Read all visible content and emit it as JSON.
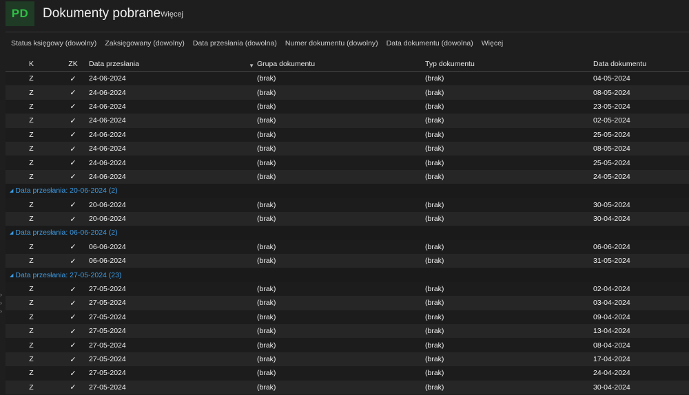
{
  "header": {
    "logo": "PD",
    "title": "Dokumenty pobrane",
    "more_label": "Więcej"
  },
  "filters": [
    "Status księgowy (dowolny)",
    "Zaksięgowany (dowolny)",
    "Data przesłania (dowolna)",
    "Numer dokumentu (dowolny)",
    "Data dokumentu (dowolna)",
    "Więcej"
  ],
  "columns": {
    "k": "K",
    "zk": "ZK",
    "data_przeslania": "Data przesłania",
    "grupa": "Grupa dokumentu",
    "typ": "Typ dokumentu",
    "data_dokumentu": "Data dokumentu"
  },
  "check_symbol": "✓",
  "sections": [
    {
      "group_label": "",
      "rows": [
        {
          "k": "Z",
          "dp": "24-06-2024",
          "grupa": "(brak)",
          "typ": "(brak)",
          "dd": "04-05-2024"
        },
        {
          "k": "Z",
          "dp": "24-06-2024",
          "grupa": "(brak)",
          "typ": "(brak)",
          "dd": "08-05-2024"
        },
        {
          "k": "Z",
          "dp": "24-06-2024",
          "grupa": "(brak)",
          "typ": "(brak)",
          "dd": "23-05-2024"
        },
        {
          "k": "Z",
          "dp": "24-06-2024",
          "grupa": "(brak)",
          "typ": "(brak)",
          "dd": "02-05-2024"
        },
        {
          "k": "Z",
          "dp": "24-06-2024",
          "grupa": "(brak)",
          "typ": "(brak)",
          "dd": "25-05-2024"
        },
        {
          "k": "Z",
          "dp": "24-06-2024",
          "grupa": "(brak)",
          "typ": "(brak)",
          "dd": "08-05-2024"
        },
        {
          "k": "Z",
          "dp": "24-06-2024",
          "grupa": "(brak)",
          "typ": "(brak)",
          "dd": "25-05-2024"
        },
        {
          "k": "Z",
          "dp": "24-06-2024",
          "grupa": "(brak)",
          "typ": "(brak)",
          "dd": "24-05-2024"
        }
      ]
    },
    {
      "group_label": "Data przesłania: 20-06-2024 (2)",
      "rows": [
        {
          "k": "Z",
          "dp": "20-06-2024",
          "grupa": "(brak)",
          "typ": "(brak)",
          "dd": "30-05-2024"
        },
        {
          "k": "Z",
          "dp": "20-06-2024",
          "grupa": "(brak)",
          "typ": "(brak)",
          "dd": "30-04-2024"
        }
      ]
    },
    {
      "group_label": "Data przesłania: 06-06-2024 (2)",
      "rows": [
        {
          "k": "Z",
          "dp": "06-06-2024",
          "grupa": "(brak)",
          "typ": "(brak)",
          "dd": "06-06-2024"
        },
        {
          "k": "Z",
          "dp": "06-06-2024",
          "grupa": "(brak)",
          "typ": "(brak)",
          "dd": "31-05-2024"
        }
      ]
    },
    {
      "group_label": "Data przesłania: 27-05-2024 (23)",
      "rows": [
        {
          "k": "Z",
          "dp": "27-05-2024",
          "grupa": "(brak)",
          "typ": "(brak)",
          "dd": "02-04-2024"
        },
        {
          "k": "Z",
          "dp": "27-05-2024",
          "grupa": "(brak)",
          "typ": "(brak)",
          "dd": "03-04-2024"
        },
        {
          "k": "Z",
          "dp": "27-05-2024",
          "grupa": "(brak)",
          "typ": "(brak)",
          "dd": "09-04-2024"
        },
        {
          "k": "Z",
          "dp": "27-05-2024",
          "grupa": "(brak)",
          "typ": "(brak)",
          "dd": "13-04-2024"
        },
        {
          "k": "Z",
          "dp": "27-05-2024",
          "grupa": "(brak)",
          "typ": "(brak)",
          "dd": "08-04-2024"
        },
        {
          "k": "Z",
          "dp": "27-05-2024",
          "grupa": "(brak)",
          "typ": "(brak)",
          "dd": "17-04-2024"
        },
        {
          "k": "Z",
          "dp": "27-05-2024",
          "grupa": "(brak)",
          "typ": "(brak)",
          "dd": "24-04-2024"
        },
        {
          "k": "Z",
          "dp": "27-05-2024",
          "grupa": "(brak)",
          "typ": "(brak)",
          "dd": "30-04-2024"
        }
      ]
    }
  ],
  "icons": {
    "sort": "triangle-down-icon",
    "group_toggle": "triangle-collapse-icon",
    "edge": "chevron-right-icon"
  },
  "colors": {
    "logo_bg": "#1f3b25",
    "logo_fg": "#2fbf45",
    "group_text": "#3d9ee8",
    "background": "#1e1e1e"
  }
}
